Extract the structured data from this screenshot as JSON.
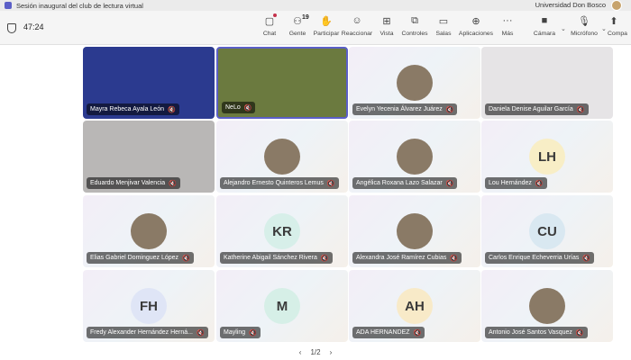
{
  "window": {
    "title": "Sesión inaugural del club de lectura virtual",
    "org": "Universidad Don Bosco"
  },
  "toolbar": {
    "timer": "47:24",
    "items": [
      {
        "label": "Chat",
        "icon": "chat-icon"
      },
      {
        "label": "Gente",
        "icon": "people-icon",
        "count": "19"
      },
      {
        "label": "Participar",
        "icon": "raise-hand-icon"
      },
      {
        "label": "Reaccionar",
        "icon": "emoji-icon"
      },
      {
        "label": "Vista",
        "icon": "view-icon"
      },
      {
        "label": "Controles",
        "icon": "controls-icon"
      },
      {
        "label": "Salas",
        "icon": "rooms-icon"
      },
      {
        "label": "Aplicaciones",
        "icon": "apps-icon"
      },
      {
        "label": "Más",
        "icon": "more-icon"
      },
      {
        "label": "Cámara",
        "icon": "camera-icon"
      },
      {
        "label": "Micrófono",
        "icon": "mic-off-icon"
      },
      {
        "label": "Compa",
        "icon": "share-icon"
      }
    ]
  },
  "participants": [
    {
      "name": "Mayra Rebeca Ayala León",
      "kind": "video"
    },
    {
      "name": "NeLo",
      "kind": "video"
    },
    {
      "name": "Evelyn Yecenia Álvarez Juárez",
      "kind": "photo"
    },
    {
      "name": "Daniela Denise Aguilar García",
      "kind": "video"
    },
    {
      "name": "Eduardo Menjivar Valencia",
      "kind": "video"
    },
    {
      "name": "Alejandro Ernesto Quinteros Lemus",
      "kind": "photo"
    },
    {
      "name": "Angélica Roxana Lazo Salazar",
      "kind": "photo"
    },
    {
      "name": "Lou Hernández",
      "kind": "initials",
      "initials": "LH",
      "color": "#f8eec6"
    },
    {
      "name": "Elias Gabriel Dominguez López",
      "kind": "photo"
    },
    {
      "name": "Katherine Abigail Sánchez Rivera",
      "kind": "initials",
      "initials": "KR",
      "color": "#d7efe9"
    },
    {
      "name": "Alexandra José Ramírez Cubias",
      "kind": "photo"
    },
    {
      "name": "Carlos Enrique Echeverria Urías",
      "kind": "initials",
      "initials": "CU",
      "color": "#d9e8f1"
    },
    {
      "name": "Fredy Alexander Hernández Herná...",
      "kind": "initials",
      "initials": "FH",
      "color": "#dfe5f6"
    },
    {
      "name": "Mayling",
      "kind": "initials",
      "initials": "M",
      "color": "#d6efe7"
    },
    {
      "name": "ADA HERNANDEZ",
      "kind": "initials",
      "initials": "AH",
      "color": "#f8eac8"
    },
    {
      "name": "Antonio José Santos Vasquez",
      "kind": "photo"
    }
  ],
  "pager": {
    "label": "1/2"
  }
}
